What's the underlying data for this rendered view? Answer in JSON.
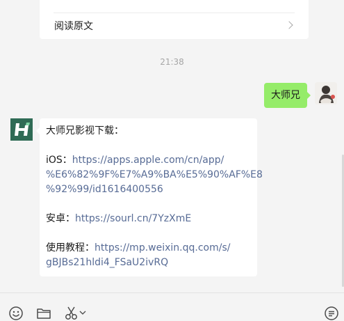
{
  "chat": {
    "previous_card": {
      "read_more": "阅读原文"
    },
    "timestamp": "21:38",
    "my_message": {
      "text": "大师兄"
    },
    "bot_message": {
      "title": "大师兄影视下载：",
      "ios_label": "iOS：",
      "ios_link_1": "https://apps.apple.com/cn/app/",
      "ios_link_2": "%E6%82%9F%E7%A9%BA%E5%90%AF%E8",
      "ios_link_3": "%92%99/id1616400556",
      "android_label": "安卓：",
      "android_link": "https://sourl.cn/7YzXmE",
      "tutorial_label": "使用教程：",
      "tutorial_link_1": "https://mp.weixin.qq.com/s/",
      "tutorial_link_2": "gBJBs21hldi4_FSaU2ivRQ"
    }
  },
  "toolbar": {
    "icons": [
      "emoji-icon",
      "folder-icon",
      "scissors-icon",
      "chevron-down-icon",
      "chat-history-icon"
    ]
  },
  "colors": {
    "background": "#f4f4f4",
    "my_bubble": "#95ec69",
    "link": "#576b95",
    "bot_avatar": "#2f6b55"
  }
}
